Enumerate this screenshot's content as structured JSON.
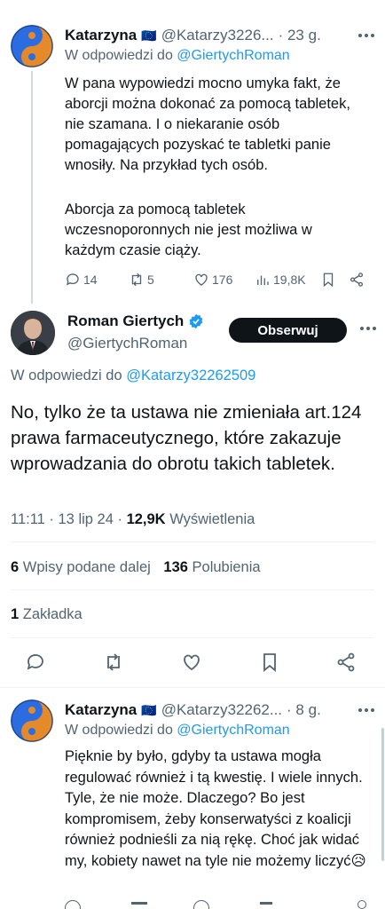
{
  "tweet1": {
    "author": "Katarzyna",
    "flag": "🇪🇺",
    "handle": "@Katarzy3226...",
    "time": "· 23 g.",
    "reply_prefix": "W odpowiedzi do",
    "reply_to": "@GiertychRoman",
    "paragraph1": "W pana wypowiedzi mocno umyka fakt, że aborcji można dokonać za pomocą tabletek, nie szamana. I o niekaranie osób pomagających pozyskać te tabletki panie wnosiły. Na przykład tych osób.",
    "paragraph2": "Aborcja za pomocą tabletek wczesnoporonnych nie jest możliwa w każdym czasie ciąży.",
    "replies": "14",
    "retweets": "5",
    "likes": "176",
    "views": "19,8K"
  },
  "main": {
    "author": "Roman Giertych",
    "handle": "@GiertychRoman",
    "follow_label": "Obserwuj",
    "reply_prefix": "W odpowiedzi do",
    "reply_to": "@Katarzy32262509",
    "text": "No, tylko że ta ustawa nie zmieniała art.124 prawa farmaceutycznego, które zakazuje wprowadzania do obrotu takich tabletek.",
    "time_date": "11:11 · 13 lip 24 ·",
    "views_count": "12,9K",
    "views_label": "Wyświetlenia",
    "reposts_count": "6",
    "reposts_label": "Wpisy podane dalej",
    "likes_count": "136",
    "likes_label": "Polubienia",
    "bookmarks_count": "1",
    "bookmarks_label": "Zakładka"
  },
  "tweet3": {
    "author": "Katarzyna",
    "flag": "🇪🇺",
    "handle": "@Katarzy32262...",
    "time": "· 8 g.",
    "reply_prefix": "W odpowiedzi do",
    "reply_to": "@GiertychRoman",
    "text": "Pięknie by było, gdyby ta ustawa mogła regulować również i tą kwestię. I wiele innych. Tyle, że nie może. Dlaczego? Bo jest kompromisem, żeby konserwatyści z koalicji również podnieśli za nią rękę. Choć jak widać my, kobiety nawet na tyle nie możemy liczyć😥"
  },
  "colors": {
    "accent": "#1d9bf0",
    "text": "#0f1419",
    "secondary": "#536471",
    "verified": "#1d9bf0"
  },
  "icons": [
    "reply-icon",
    "retweet-icon",
    "like-icon",
    "views-icon",
    "bookmark-icon",
    "share-icon",
    "verified-icon",
    "more-icon",
    "yin-yang-avatar-icon"
  ]
}
